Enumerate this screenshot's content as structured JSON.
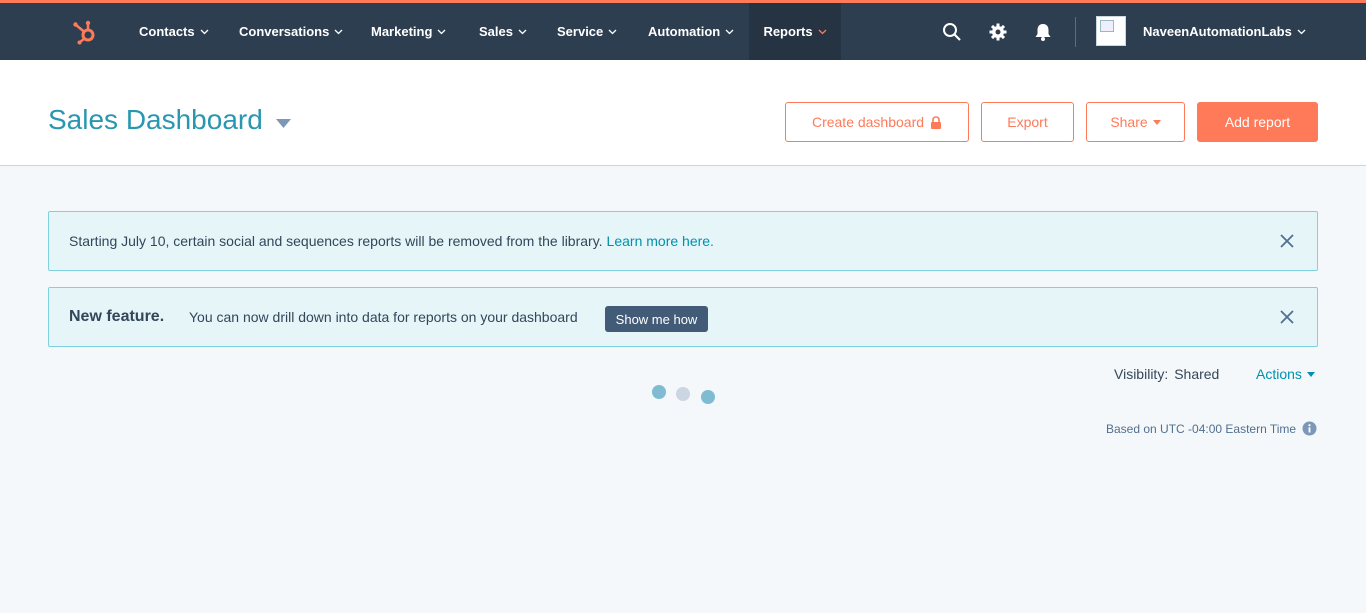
{
  "nav": {
    "items": [
      {
        "label": "Contacts"
      },
      {
        "label": "Conversations"
      },
      {
        "label": "Marketing"
      },
      {
        "label": "Sales"
      },
      {
        "label": "Service"
      },
      {
        "label": "Automation"
      },
      {
        "label": "Reports",
        "active": true
      }
    ],
    "account_name": "NaveenAutomationLabs",
    "icons": [
      "hubspot-logo",
      "search-icon",
      "gear-icon",
      "bell-icon"
    ]
  },
  "header": {
    "title": "Sales Dashboard",
    "buttons": {
      "create": "Create dashboard",
      "export": "Export",
      "share": "Share",
      "add": "Add report"
    }
  },
  "alerts": {
    "notice": {
      "text": "Starting July 10, certain social and sequences reports will be removed from the library.",
      "link": "Learn more here."
    },
    "feature": {
      "title": "New feature.",
      "text": "You can now drill down into data for reports on your dashboard",
      "button": "Show me how"
    }
  },
  "meta": {
    "visibility_label": "Visibility:",
    "visibility_value": "Shared",
    "actions": "Actions",
    "timezone": "Based on UTC -04:00 Eastern Time"
  },
  "colors": {
    "accent": "#ff7a59",
    "nav_bg": "#2d3e50",
    "title": "#2a97b0",
    "link": "#0091ae"
  }
}
